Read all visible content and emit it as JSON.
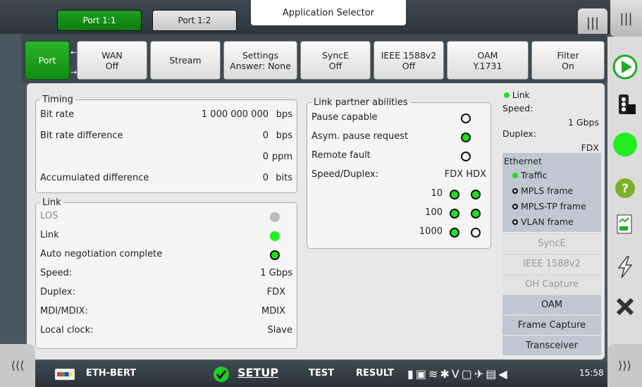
{
  "top": {
    "port_tabs": [
      "Port 1:1",
      "Port 1:2"
    ],
    "app_selector": "Application Selector",
    "right_tab_icons": [
      "panel-icon",
      "panel-icon"
    ]
  },
  "tabs": [
    {
      "l1": "Port",
      "l2": ""
    },
    {
      "l1": "WAN",
      "l2": "Off"
    },
    {
      "l1": "Stream",
      "l2": ""
    },
    {
      "l1": "Settings",
      "l2": "Answer: None"
    },
    {
      "l1": "SyncE",
      "l2": "Off"
    },
    {
      "l1": "IEEE 1588v2",
      "l2": "Off"
    },
    {
      "l1": "OAM",
      "l2": "Y.1731"
    },
    {
      "l1": "Filter",
      "l2": "On"
    }
  ],
  "timing": {
    "title": "Timing",
    "rows": [
      {
        "label": "Bit rate",
        "value": "1 000 000 000",
        "unit": "bps"
      },
      {
        "label": "Bit rate difference",
        "value": "0",
        "unit": "bps"
      },
      {
        "label": "",
        "value": "0",
        "unit": "ppm"
      },
      {
        "label": "Accumulated difference",
        "value": "0",
        "unit": "bits"
      }
    ]
  },
  "link": {
    "title": "Link",
    "los": "LOS",
    "link": "Link",
    "auto": "Auto negotiation complete",
    "speed_label": "Speed:",
    "speed_value": "1 Gbps",
    "duplex_label": "Duplex:",
    "duplex_value": "FDX",
    "mdi_label": "MDI/MDIX:",
    "mdi_value": "MDIX",
    "clock_label": "Local clock:",
    "clock_value": "Slave"
  },
  "partner": {
    "title": "Link partner abilities",
    "pause": "Pause capable",
    "asym": "Asym. pause request",
    "remote": "Remote fault",
    "sd_label": "Speed/Duplex:",
    "sd_head": "FDX HDX",
    "speeds": [
      "10",
      "100",
      "1000"
    ]
  },
  "status": {
    "link": "Link",
    "speed_label": "Speed:",
    "speed_value": "1 Gbps",
    "duplex_label": "Duplex:",
    "duplex_value": "FDX",
    "ethernet": "Ethernet",
    "traffic": "Traffic",
    "mpls": "MPLS frame",
    "mplstp": "MPLS-TP frame",
    "vlan": "VLAN frame",
    "buttons": [
      {
        "label": "SyncE",
        "enabled": false
      },
      {
        "label": "IEEE 1588v2",
        "enabled": false
      },
      {
        "label": "OH Capture",
        "enabled": false
      },
      {
        "label": "OAM",
        "enabled": true
      },
      {
        "label": "Frame Capture",
        "enabled": true
      },
      {
        "label": "Transceiver",
        "enabled": true
      }
    ]
  },
  "bottom": {
    "app_name": "ETH-BERT",
    "setup": "SETUP",
    "test": "TEST",
    "result": "RESULT",
    "time": "15:58"
  },
  "colors": {
    "accent_green": "#22dd22",
    "tab_active": "#1ea01e"
  }
}
